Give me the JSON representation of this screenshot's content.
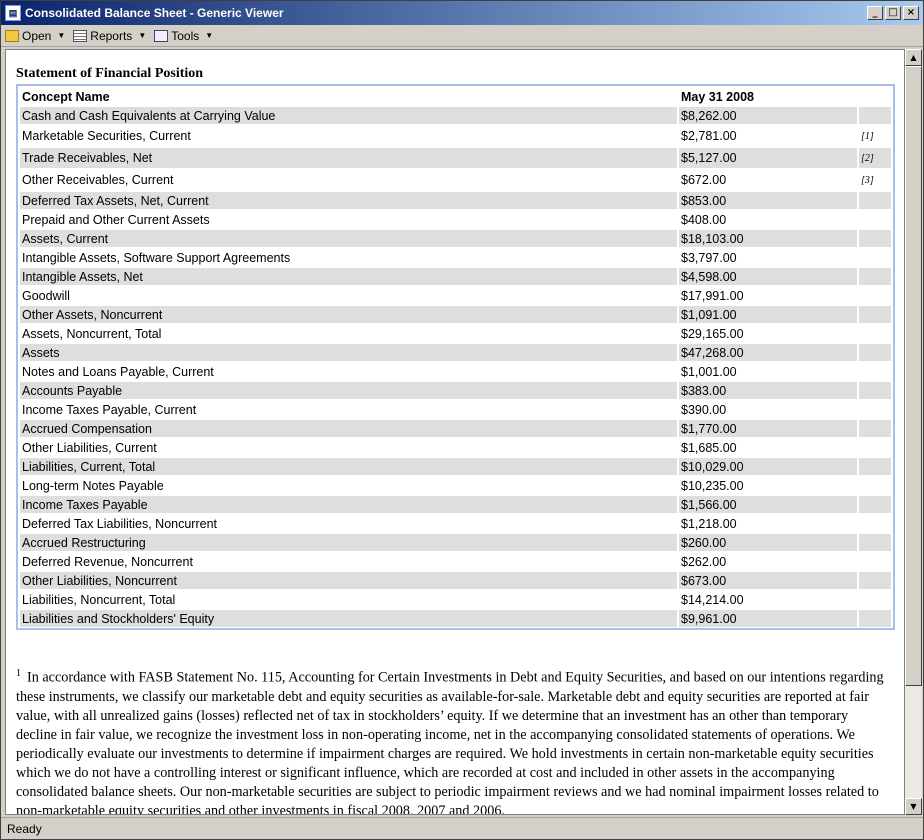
{
  "window": {
    "title": "Consolidated Balance Sheet - Generic Viewer",
    "buttons": [
      "_",
      "□",
      "×"
    ]
  },
  "toolbar": {
    "items": [
      {
        "label": "Open",
        "icon": "folder-open-icon"
      },
      {
        "label": "Reports",
        "icon": "report-icon"
      },
      {
        "label": "Tools",
        "icon": "tools-icon"
      }
    ]
  },
  "main": {
    "heading": "Statement of Financial Position",
    "table": {
      "headers": [
        "Concept Name",
        "May 31 2008",
        ""
      ],
      "rows": [
        {
          "name": "Cash and Cash Equivalents at Carrying Value",
          "value": "$8,262.00",
          "fn": ""
        },
        {
          "name": "Marketable Securities, Current",
          "value": "$2,781.00",
          "fn": "[1]"
        },
        {
          "name": "Trade Receivables, Net",
          "value": "$5,127.00",
          "fn": "[2]"
        },
        {
          "name": "Other Receivables, Current",
          "value": "$672.00",
          "fn": "[3]"
        },
        {
          "name": "Deferred Tax Assets, Net, Current",
          "value": "$853.00",
          "fn": ""
        },
        {
          "name": "Prepaid and Other Current Assets",
          "value": "$408.00",
          "fn": ""
        },
        {
          "name": "Assets, Current",
          "value": "$18,103.00",
          "fn": ""
        },
        {
          "name": "Intangible Assets, Software Support Agreements",
          "value": "$3,797.00",
          "fn": ""
        },
        {
          "name": "Intangible Assets, Net",
          "value": "$4,598.00",
          "fn": ""
        },
        {
          "name": "Goodwill",
          "value": "$17,991.00",
          "fn": ""
        },
        {
          "name": "Other Assets, Noncurrent",
          "value": "$1,091.00",
          "fn": ""
        },
        {
          "name": "Assets, Noncurrent, Total",
          "value": "$29,165.00",
          "fn": ""
        },
        {
          "name": "Assets",
          "value": "$47,268.00",
          "fn": ""
        },
        {
          "name": "Notes and Loans Payable, Current",
          "value": "$1,001.00",
          "fn": ""
        },
        {
          "name": "Accounts Payable",
          "value": "$383.00",
          "fn": ""
        },
        {
          "name": "Income Taxes Payable, Current",
          "value": "$390.00",
          "fn": ""
        },
        {
          "name": "Accrued Compensation",
          "value": "$1,770.00",
          "fn": ""
        },
        {
          "name": "Other Liabilities, Current",
          "value": "$1,685.00",
          "fn": ""
        },
        {
          "name": "Liabilities, Current, Total",
          "value": "$10,029.00",
          "fn": ""
        },
        {
          "name": "Long-term Notes Payable",
          "value": "$10,235.00",
          "fn": ""
        },
        {
          "name": "Income Taxes Payable",
          "value": "$1,566.00",
          "fn": ""
        },
        {
          "name": "Deferred Tax Liabilities, Noncurrent",
          "value": "$1,218.00",
          "fn": ""
        },
        {
          "name": "Accrued Restructuring",
          "value": "$260.00",
          "fn": ""
        },
        {
          "name": "Deferred Revenue, Noncurrent",
          "value": "$262.00",
          "fn": ""
        },
        {
          "name": "Other Liabilities, Noncurrent",
          "value": "$673.00",
          "fn": ""
        },
        {
          "name": "Liabilities, Noncurrent, Total",
          "value": "$14,214.00",
          "fn": ""
        },
        {
          "name": "Liabilities and Stockholders' Equity",
          "value": "$9,961.00",
          "fn": ""
        }
      ]
    },
    "footnote": {
      "marker": "1",
      "text": "In accordance with FASB Statement No. 115, Accounting for Certain Investments in Debt and Equity Securities, and based on our intentions regarding these instruments, we classify our marketable debt and equity securities as available-for-sale. Marketable debt and equity securities are reported at fair value, with all unrealized gains (losses) reflected net of tax in stockholders’ equity. If we determine that an investment has an other than temporary decline in fair value, we recognize the investment loss in non-operating income, net in the accompanying consolidated statements of operations. We periodically evaluate our investments to determine if impairment charges are required. We hold investments in certain non-marketable equity securities which we do not have a controlling interest or significant influence, which are recorded at cost and included in other assets in the accompanying consolidated balance sheets. Our non-marketable securities are subject to periodic impairment reviews and we had nominal impairment losses related to non-marketable equity securities and other investments in fiscal 2008, 2007 and 2006."
    }
  },
  "status": {
    "text": "Ready"
  },
  "colors": {
    "title_start": "#0a246a",
    "title_end": "#a6caf0",
    "row_alt": "#dedede",
    "table_border": "#a8c0e8"
  }
}
